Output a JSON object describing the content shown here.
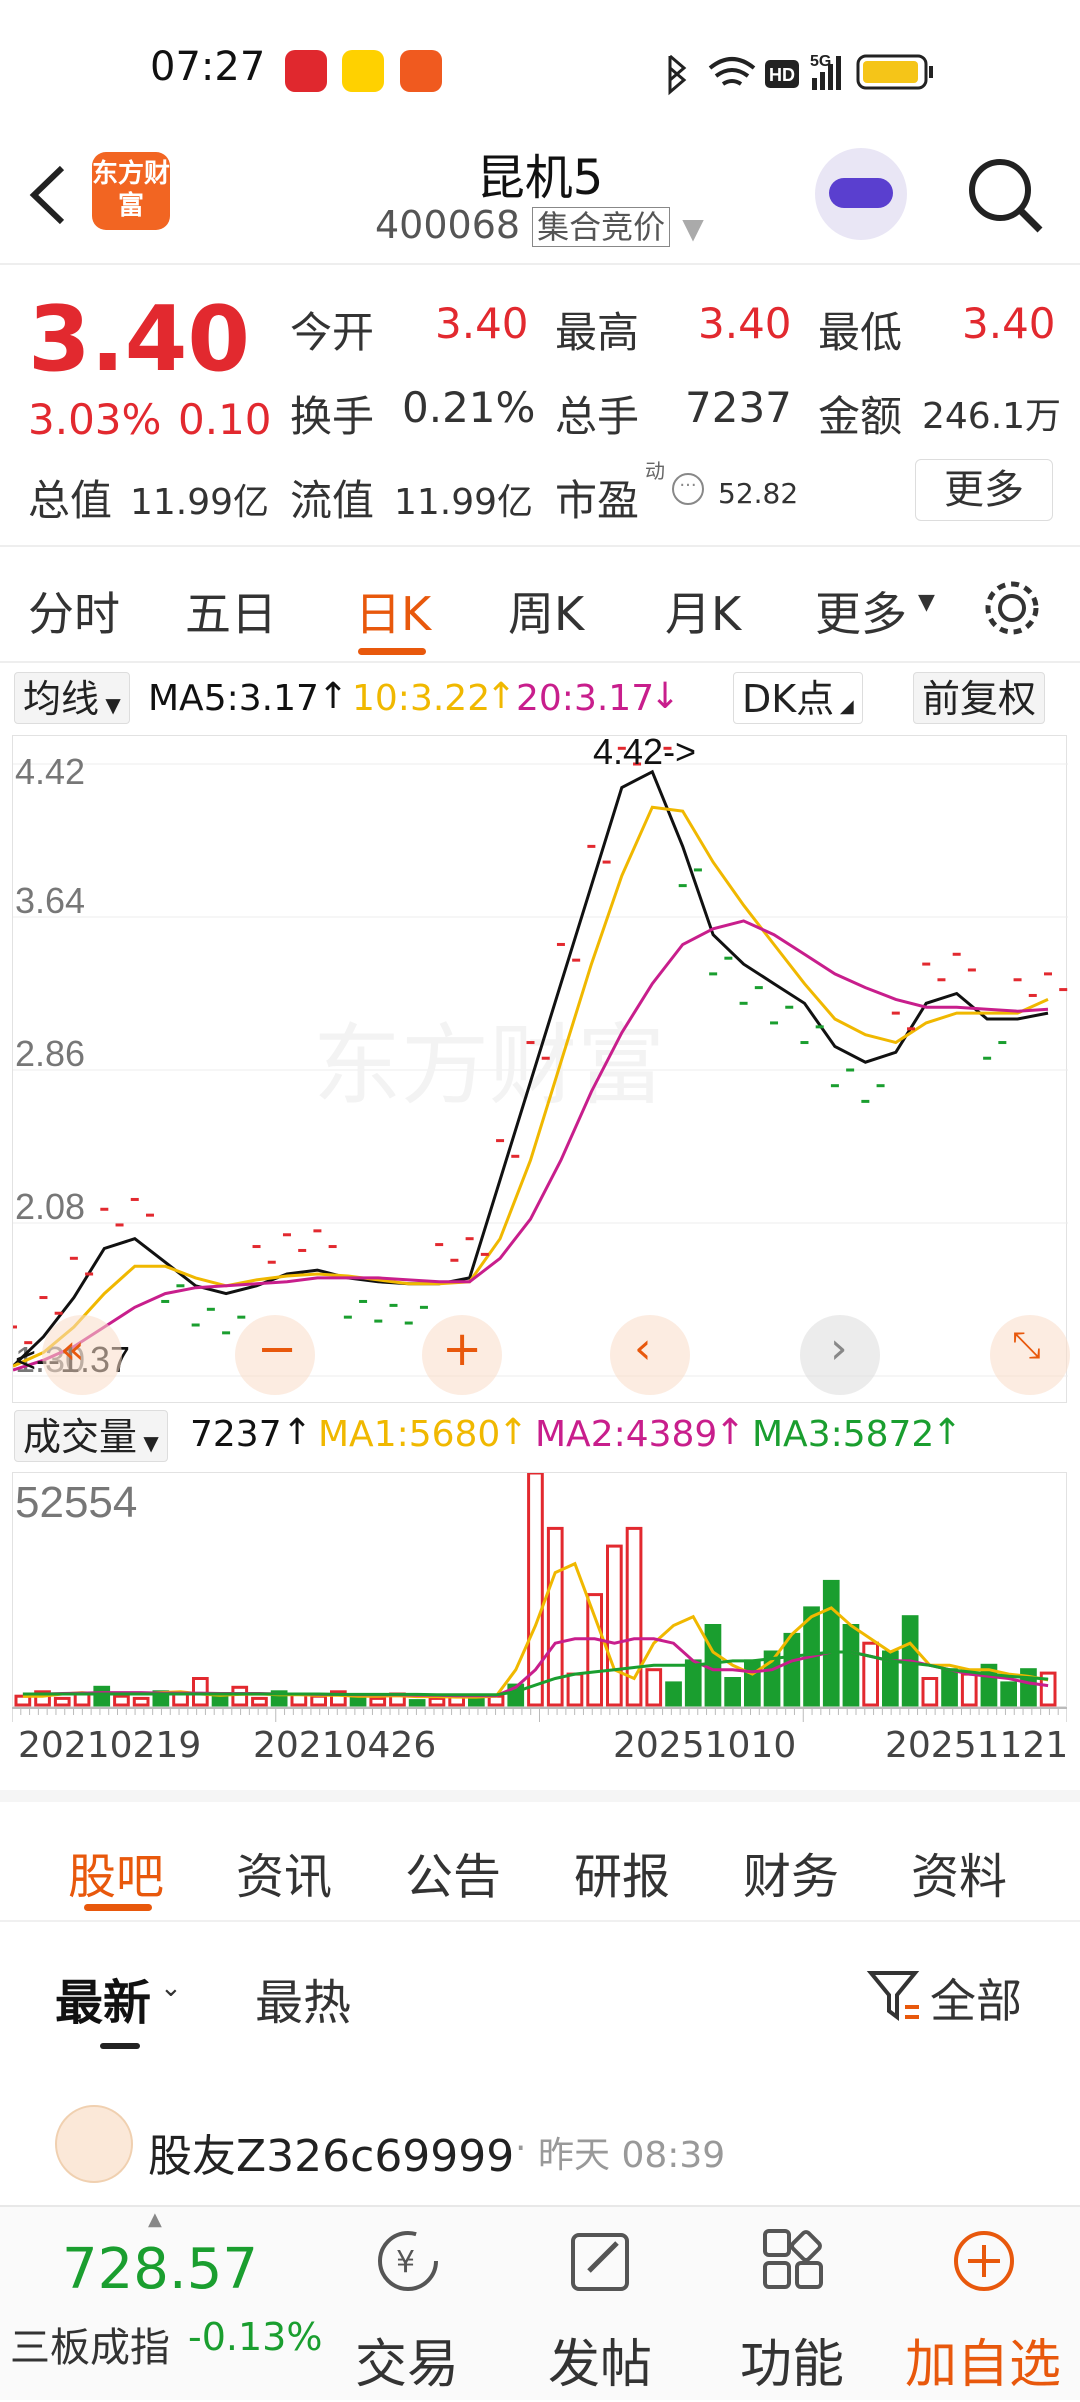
{
  "status_bar": {
    "time": "07:27",
    "app_icons": [
      "pinduoduo-icon",
      "meituan-icon",
      "feishu-icon"
    ],
    "indicators": [
      "bluetooth-icon",
      "wifi-icon",
      "hd-icon",
      "5g-signal-icon",
      "battery-icon"
    ]
  },
  "header": {
    "title": "昆机5",
    "code": "400068",
    "session_tag": "集合竞价",
    "logo_text": "东方财富"
  },
  "quote": {
    "price": "3.40",
    "change_pct": "3.03%",
    "change_abs": "0.10",
    "open_label": "今开",
    "open": "3.40",
    "high_label": "最高",
    "high": "3.40",
    "low_label": "最低",
    "low": "3.40",
    "turnover_label": "换手",
    "turnover": "0.21%",
    "volume_label": "总手",
    "volume": "7237",
    "amount_label": "金额",
    "amount": "246.1万",
    "mcap_label": "总值",
    "mcap": "11.99亿",
    "float_label": "流值",
    "float_mcap": "11.99亿",
    "pe_label": "市盈",
    "pe_sup": "动",
    "pe": "52.82",
    "more_button": "更多"
  },
  "chart_tabs": [
    "分时",
    "五日",
    "日K",
    "周K",
    "月K",
    "更多"
  ],
  "active_chart_tab": "日K",
  "ma_legend": {
    "selector": "均线",
    "ma5": "MA5:3.17",
    "ma10": "10:3.22",
    "ma20": "20:3.17",
    "dk_button": "DK点",
    "adjust_button": "前复权"
  },
  "colors": {
    "up": "#e2292f",
    "down": "#1a9e2f",
    "ma5": "#111111",
    "ma10": "#f0b800",
    "ma20": "#c81e8c",
    "accent": "#e8580c"
  },
  "chart_data": [
    {
      "type": "line",
      "title": "日K",
      "y_ticks": [
        "4.42",
        "3.64",
        "2.86",
        "2.08",
        "1.30"
      ],
      "ylim": [
        1.3,
        4.42
      ],
      "annotations": [
        "4.42->",
        "<--1.37"
      ],
      "series": [
        {
          "name": "MA5",
          "values": [
            1.35,
            1.5,
            1.7,
            1.95,
            2.0,
            1.88,
            1.76,
            1.72,
            1.76,
            1.82,
            1.84,
            1.8,
            1.78,
            1.77,
            1.77,
            1.8,
            2.3,
            2.8,
            3.3,
            3.8,
            4.3,
            4.38,
            4.0,
            3.55,
            3.4,
            3.3,
            3.2,
            2.98,
            2.9,
            2.95,
            3.2,
            3.25,
            3.12,
            3.12,
            3.15
          ]
        },
        {
          "name": "10",
          "values": [
            1.35,
            1.42,
            1.55,
            1.72,
            1.86,
            1.86,
            1.8,
            1.76,
            1.79,
            1.81,
            1.82,
            1.81,
            1.79,
            1.77,
            1.77,
            1.78,
            2.0,
            2.4,
            2.9,
            3.4,
            3.85,
            4.2,
            4.18,
            3.92,
            3.7,
            3.5,
            3.3,
            3.12,
            3.04,
            3.0,
            3.1,
            3.15,
            3.15,
            3.15,
            3.22
          ]
        },
        {
          "name": "20",
          "values": [
            1.33,
            1.38,
            1.45,
            1.55,
            1.65,
            1.72,
            1.75,
            1.76,
            1.77,
            1.78,
            1.8,
            1.8,
            1.8,
            1.79,
            1.78,
            1.78,
            1.9,
            2.1,
            2.4,
            2.75,
            3.05,
            3.3,
            3.5,
            3.58,
            3.62,
            3.55,
            3.45,
            3.35,
            3.28,
            3.22,
            3.18,
            3.18,
            3.17,
            3.16,
            3.17
          ]
        }
      ]
    },
    {
      "type": "bar",
      "title": "成交量",
      "legend": {
        "selector": "成交量",
        "vol": "7237",
        "ma1": "MA1:5680",
        "ma2": "MA2:4389",
        "ma3": "MA3:5872"
      },
      "y_ticks": [
        "52554"
      ],
      "ylim": [
        0,
        52554
      ],
      "x_tick_labels": [
        "20210219",
        "20210426",
        "20251010",
        "20251121"
      ],
      "values": [
        2000,
        3000,
        1500,
        2500,
        4000,
        2000,
        1500,
        3000,
        2500,
        6000,
        2000,
        4000,
        1500,
        3000,
        2500,
        2000,
        3000,
        2000,
        1500,
        2500,
        1000,
        1500,
        2000,
        1500,
        2000,
        4500,
        52554,
        40000,
        7000,
        25000,
        36000,
        40000,
        8000,
        5000,
        10000,
        18000,
        6000,
        10000,
        12000,
        16000,
        22000,
        28000,
        18000,
        14000,
        12000,
        20000,
        6000,
        8000,
        7000,
        9000,
        5000,
        8000,
        7237
      ],
      "colors": [
        "r",
        "r",
        "r",
        "r",
        "g",
        "r",
        "r",
        "g",
        "r",
        "r",
        "g",
        "r",
        "r",
        "g",
        "r",
        "r",
        "r",
        "g",
        "r",
        "r",
        "g",
        "r",
        "r",
        "g",
        "r",
        "g",
        "r",
        "r",
        "r",
        "r",
        "r",
        "r",
        "r",
        "g",
        "g",
        "g",
        "g",
        "g",
        "g",
        "g",
        "g",
        "g",
        "g",
        "r",
        "g",
        "g",
        "r",
        "g",
        "r",
        "g",
        "g",
        "g",
        "r"
      ],
      "series": [
        {
          "name": "MA1",
          "values": [
            2000,
            2000,
            2500,
            2800,
            2500,
            2600,
            2600,
            2800,
            3000,
            2500,
            2200,
            2400,
            2500,
            2300,
            2300,
            2200,
            2200,
            2000,
            2000,
            2100,
            1900,
            1900,
            1800,
            1800,
            2000,
            8000,
            18000,
            30000,
            32000,
            20000,
            8000,
            6000,
            14000,
            18000,
            20000,
            12000,
            9000,
            7000,
            10000,
            16000,
            20000,
            22000,
            18000,
            15000,
            12000,
            14000,
            9000,
            9000,
            8000,
            8000,
            7000,
            6500,
            5680
          ]
        },
        {
          "name": "MA2",
          "values": [
            2500,
            2500,
            2600,
            2700,
            2800,
            2800,
            2800,
            2700,
            2700,
            2700,
            2600,
            2600,
            2600,
            2500,
            2500,
            2400,
            2400,
            2300,
            2300,
            2300,
            2200,
            2200,
            2100,
            2100,
            2100,
            4000,
            8000,
            14000,
            15000,
            15000,
            14000,
            15000,
            15000,
            14000,
            10000,
            8000,
            8000,
            7500,
            8000,
            10000,
            11000,
            12000,
            12000,
            11000,
            10000,
            10000,
            9000,
            8000,
            7000,
            6500,
            6000,
            5000,
            4389
          ]
        },
        {
          "name": "MA3",
          "values": [
            2500,
            2500,
            2500,
            2500,
            2500,
            2500,
            2500,
            2500,
            2500,
            2500,
            2500,
            2500,
            2500,
            2500,
            2500,
            2500,
            2400,
            2400,
            2400,
            2400,
            2400,
            2300,
            2300,
            2300,
            2300,
            3000,
            4500,
            6000,
            7000,
            7500,
            8000,
            8500,
            9000,
            9000,
            9000,
            9500,
            10000,
            10000,
            10500,
            11000,
            11500,
            12000,
            12000,
            11000,
            10000,
            9500,
            9000,
            8000,
            7500,
            7000,
            6500,
            6200,
            5872
          ]
        }
      ]
    }
  ],
  "chart_controls": [
    "double-left-icon",
    "minus-icon",
    "plus-icon",
    "left-icon",
    "right-icon",
    "expand-icon"
  ],
  "sub_tabs": [
    "股吧",
    "资讯",
    "公告",
    "研报",
    "财务",
    "资料"
  ],
  "active_sub_tab": "股吧",
  "sort": {
    "latest": "最新",
    "hot": "最热",
    "filter": "全部"
  },
  "post": {
    "user": "股友Z326c69999",
    "time": "昨天 08:39"
  },
  "index": {
    "value": "728.57",
    "name": "三板成指",
    "change": "-0.13%"
  },
  "bottom_nav": {
    "trade": "交易",
    "post": "发帖",
    "functions": "功能",
    "add": "加自选"
  }
}
